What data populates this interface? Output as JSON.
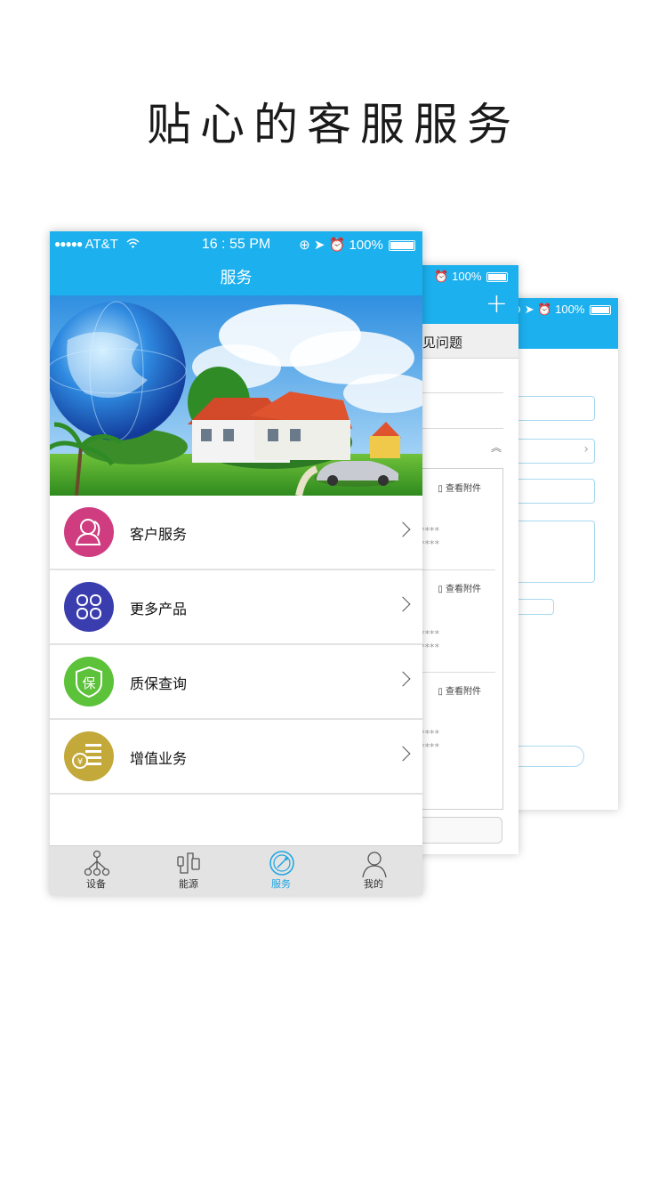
{
  "headline": "贴心的客服服务",
  "back_screen_3": {
    "battery": "100%"
  },
  "back_screen_2": {
    "battery": "100%",
    "tab_title": "常见问题",
    "attach_label": "查看附件",
    "masked": "****"
  },
  "main_screen": {
    "status": {
      "carrier": "AT&T",
      "time": "16 : 55 PM",
      "battery": "100%"
    },
    "title": "服务",
    "menu": [
      {
        "label": "客户服务",
        "icon": "customer-service-icon",
        "color": "#cf3d80"
      },
      {
        "label": "更多产品",
        "icon": "more-products-icon",
        "color": "#3a3dae"
      },
      {
        "label": "质保查询",
        "icon": "warranty-icon",
        "color": "#5cc23a"
      },
      {
        "label": "增值业务",
        "icon": "value-added-icon",
        "color": "#c3a83a"
      }
    ],
    "tabs": [
      {
        "label": "设备",
        "icon": "device-icon",
        "active": false
      },
      {
        "label": "能源",
        "icon": "energy-icon",
        "active": false
      },
      {
        "label": "服务",
        "icon": "service-icon",
        "active": true
      },
      {
        "label": "我的",
        "icon": "profile-icon",
        "active": false
      }
    ],
    "accent": "#1cb0ee"
  }
}
